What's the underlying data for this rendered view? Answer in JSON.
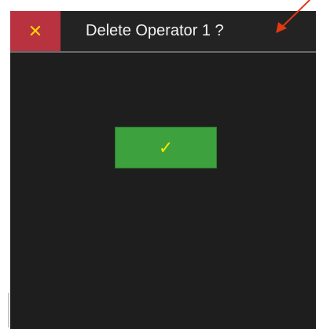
{
  "dialog": {
    "title": "Delete Operator 1 ?",
    "close_icon": "close-icon",
    "close_glyph": "✕",
    "confirm_icon": "checkmark-icon",
    "confirm_glyph": "✓"
  },
  "colors": {
    "background": "#1e1e1e",
    "titlebar": "#232323",
    "close_button": "#b83240",
    "confirm_button": "#3da23d",
    "icon": "#ffd400",
    "annotation_arrow": "#e03a12"
  }
}
